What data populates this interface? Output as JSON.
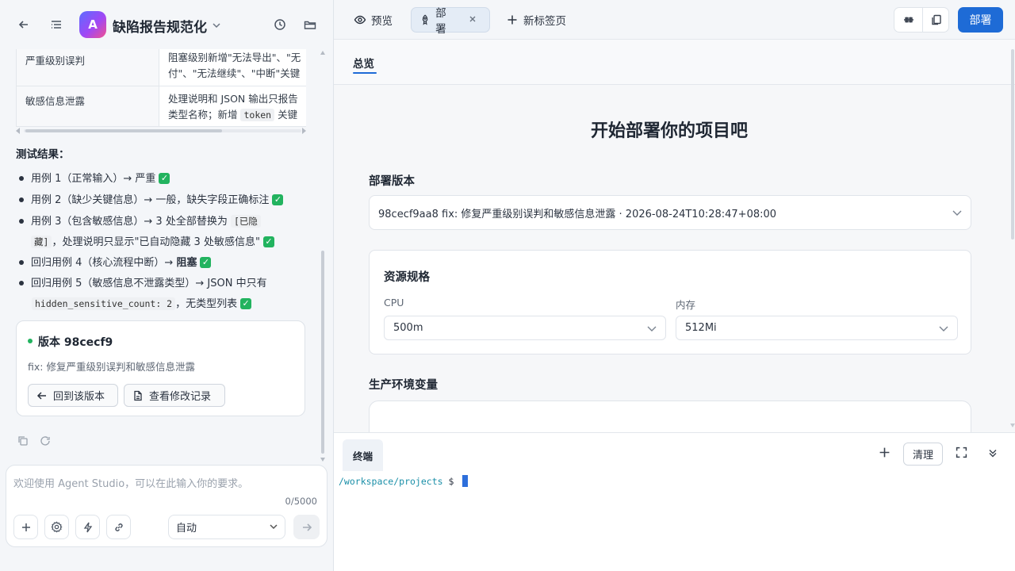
{
  "header": {
    "project_title": "缺陷报告规范化",
    "logo_letter": "A",
    "icons": [
      "back-arrow-icon",
      "list-icon",
      "chevron-down-icon",
      "history-icon",
      "folder-icon"
    ]
  },
  "table": {
    "rows": [
      {
        "name": "严重级别误判",
        "line1": "阻塞级别新增\"无法导出\"、\"无",
        "line2": "付\"、\"无法继续\"、\"中断\"关键"
      },
      {
        "name": "敏感信息泄露",
        "line1": "处理说明和 JSON 输出只报告",
        "line2_pre": "类型名称；新增 ",
        "line2_code": "token",
        "line2_post": " 关键"
      }
    ]
  },
  "results": {
    "title": "测试结果：",
    "items": [
      {
        "text": "用例 1（正常输入）→ 严重"
      },
      {
        "text": "用例 2（缺少关键信息）→ 一般，缺失字段正确标注"
      },
      {
        "text_pre": "用例 3（包含敏感信息）→ 3 处全部替换为 ",
        "code": "[已隐",
        "line2_code": "藏]",
        "line2_post": "，处理说明只显示\"已自动隐藏 3 处敏感信息\""
      },
      {
        "text_pre": "回归用例 4（核心流程中断）→ ",
        "bold": "阻塞"
      },
      {
        "text": "回归用例 5（敏感信息不泄露类型）→ JSON 中只有",
        "line2_code": "hidden_sensitive_count: 2",
        "line2_post": "，无类型列表"
      }
    ]
  },
  "version_card": {
    "title": "版本 98cecf9",
    "desc": "fix: 修复严重级别误判和敏感信息泄露",
    "restore_label": "回到该版本",
    "changes_label": "查看修改记录"
  },
  "input": {
    "placeholder": "欢迎使用 Agent Studio，可以在此输入你的要求。",
    "count": "0/5000",
    "mode": "自动"
  },
  "tabs": [
    {
      "label": "预览",
      "icon": "eye-icon"
    },
    {
      "label": "部署",
      "icon": "rocket-icon",
      "active": true
    },
    {
      "label": "新标签页",
      "icon": "plus-icon"
    }
  ],
  "toolbar": {
    "deploy_label": "部署"
  },
  "subnav": {
    "overview": "总览"
  },
  "deploy": {
    "heading": "开始部署你的项目吧",
    "version_label": "部署版本",
    "version_value": "98cecf9aa8 fix: 修复严重级别误判和敏感信息泄露 · 2026-08-24T10:28:47+08:00",
    "resource_title": "资源规格",
    "cpu_label": "CPU",
    "cpu_value": "500m",
    "mem_label": "内存",
    "mem_value": "512Mi",
    "env_title": "生产环境变量"
  },
  "terminal": {
    "tab": "终端",
    "clear_label": "清理",
    "path": "/workspace/projects",
    "dollar": "$"
  },
  "colors": {
    "accent": "#1e6bd6",
    "success": "#22b35f",
    "terminal_path": "#1a8fa8"
  }
}
